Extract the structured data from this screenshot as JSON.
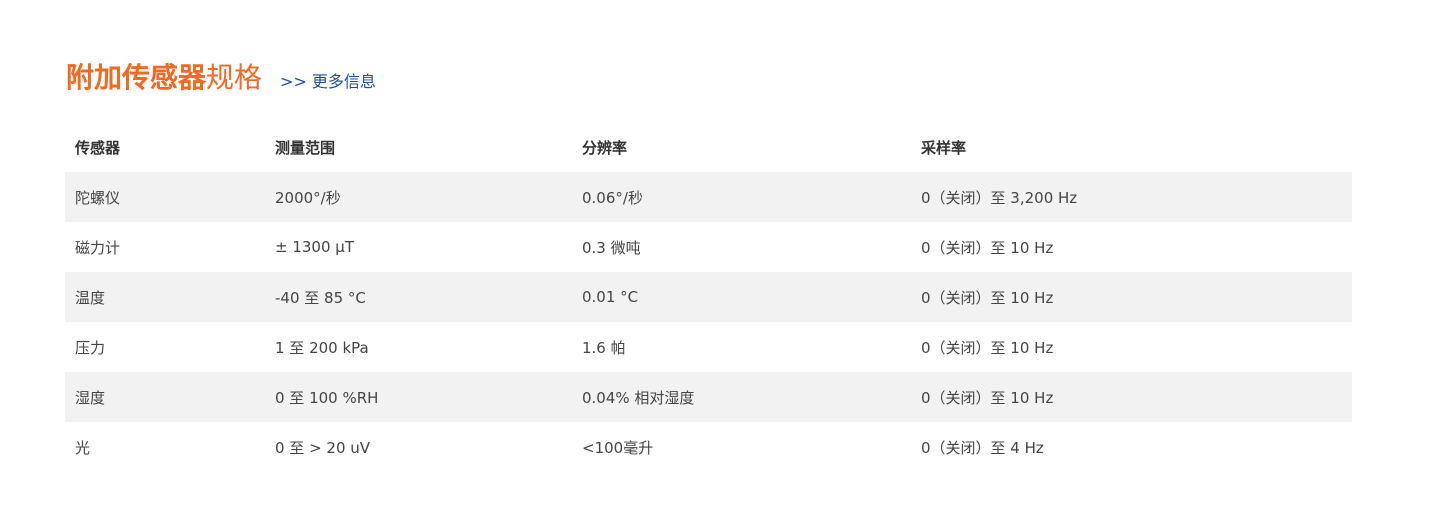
{
  "header": {
    "title_bold": "附加传感器",
    "title_light": "规格",
    "more_link": ">> 更多信息"
  },
  "table": {
    "columns": [
      "传感器",
      "测量范围",
      "分辨率",
      "采样率"
    ],
    "rows": [
      [
        "陀螺仪",
        "2000°/秒",
        "0.06°/秒",
        "0（关闭）至 3,200 Hz"
      ],
      [
        "磁力计",
        "± 1300 µT",
        "0.3 微吨",
        "0（关闭）至 10 Hz"
      ],
      [
        "温度",
        "-40 至 85 °C",
        "0.01 °C",
        "0（关闭）至 10 Hz"
      ],
      [
        "压力",
        "1 至 200 kPa",
        "1.6 帕",
        "0（关闭）至 10 Hz"
      ],
      [
        "湿度",
        "0 至 100 %RH",
        "0.04% 相对湿度",
        "0（关闭）至 10 Hz"
      ],
      [
        "光",
        "0 至 > 20 uV",
        "<100毫升",
        "0（关闭）至 4 Hz"
      ]
    ]
  },
  "colors": {
    "accent": "#f26a22",
    "link": "#1f4fa0",
    "row_stripe": "#f2f2f2"
  }
}
